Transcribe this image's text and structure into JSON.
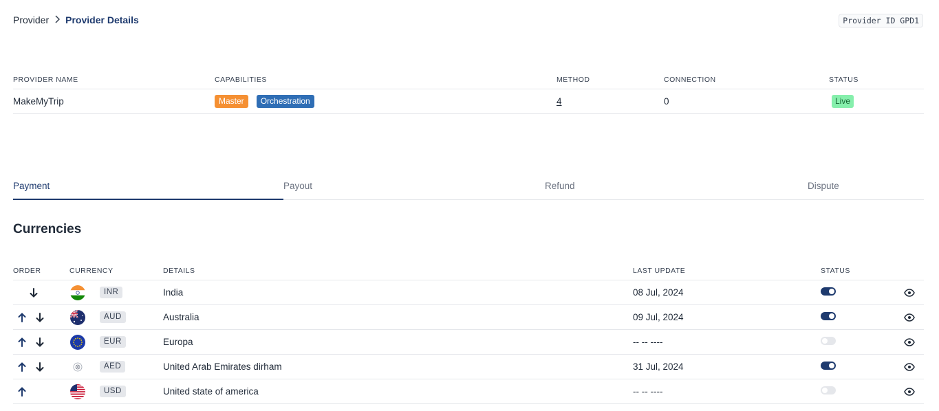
{
  "breadcrumb": {
    "parent": "Provider",
    "separator": "›",
    "current": "Provider Details"
  },
  "provider_id_label": "Provider ID GPD1",
  "provider_table": {
    "headers": {
      "name": "PROVIDER NAME",
      "capabilities": "CAPABILITIES",
      "method": "METHOD",
      "connection": "CONNECTION",
      "status": "STATUS"
    },
    "row": {
      "name": "MakeMyTrip",
      "capabilities": [
        "Master",
        "Orchestration"
      ],
      "method": "4",
      "connection": "0",
      "status": "Live"
    }
  },
  "tabs": [
    "Payment",
    "Payout",
    "Refund",
    "Dispute"
  ],
  "active_tab": "Payment",
  "section_title": "Currencies",
  "currency_table": {
    "headers": {
      "order": "ORDER",
      "currency": "CURRENCY",
      "details": "DETAILS",
      "last_update": "LAST UPDATE",
      "status": "STATUS"
    },
    "rows": [
      {
        "up": false,
        "down": true,
        "flag": "india-flag-icon",
        "code": "INR",
        "details": "India",
        "last_update": "08 Jul, 2024",
        "enabled": true
      },
      {
        "up": true,
        "down": true,
        "flag": "australia-flag-icon",
        "code": "AUD",
        "details": "Australia",
        "last_update": "09 Jul, 2024",
        "enabled": true
      },
      {
        "up": true,
        "down": true,
        "flag": "eu-flag-icon",
        "code": "EUR",
        "details": "Europa",
        "last_update": "-- -- ----",
        "enabled": false
      },
      {
        "up": true,
        "down": true,
        "flag": "uae-dirham-icon",
        "code": "AED",
        "details": "United Arab Emirates dirham",
        "last_update": "31 Jul, 2024",
        "enabled": true
      },
      {
        "up": true,
        "down": false,
        "flag": "usa-flag-icon",
        "code": "USD",
        "details": "United state of america",
        "last_update": "-- -- ----",
        "enabled": false
      }
    ]
  },
  "colors": {
    "primary": "#1e3a6e",
    "master_badge": "#f59033",
    "orchestration_badge": "#2f6eb5",
    "live_badge": "#86efac"
  }
}
